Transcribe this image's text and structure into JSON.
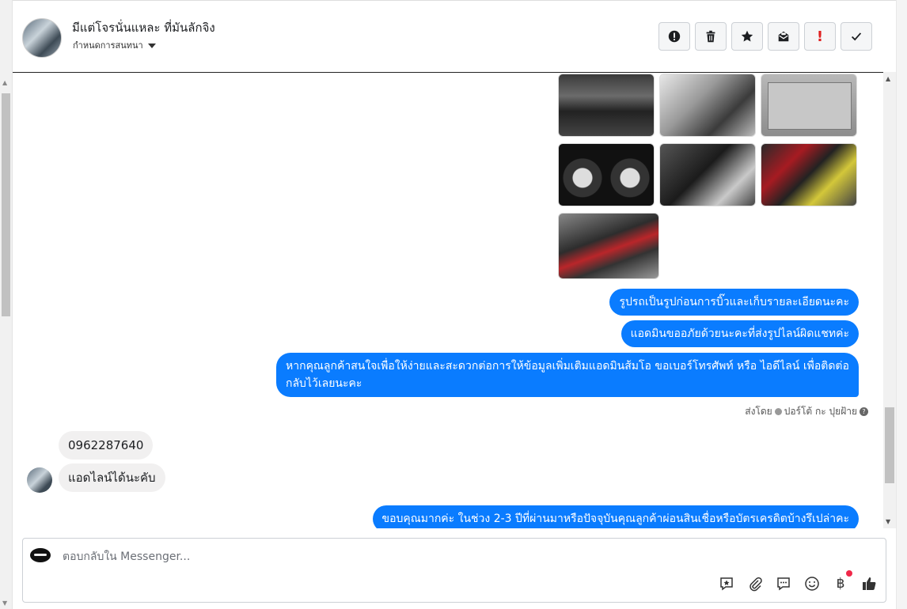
{
  "header": {
    "conversation_name": "มีแต่โจรนั่นแหละ ที่มันลักจิง",
    "assign_label": "กำหนดการสนทนา",
    "actions": [
      {
        "name": "mark-spam-button",
        "icon": "exclamation-circle-icon"
      },
      {
        "name": "delete-button",
        "icon": "trash-icon"
      },
      {
        "name": "star-button",
        "icon": "star-icon"
      },
      {
        "name": "mark-unread-button",
        "icon": "envelope-icon"
      },
      {
        "name": "follow-up-button",
        "icon": "exclamation-icon",
        "text": "!"
      },
      {
        "name": "mark-done-button",
        "icon": "check-icon"
      }
    ]
  },
  "messages": {
    "outgoing": [
      "รูปรถเป็นรูปก่อนการบิ๊วและเก็บรายละเอียดนะคะ",
      "แอดมินขออภัยด้วยนะคะที่ส่งรูปไลน์ผิดแชทค่ะ",
      "หากคุณลูกค้าสนใจเพื่อให้ง่ายและสะดวกต่อการให้ข้อมูลเพิ่มเติมแอดมินส้มโอ ขอเบอร์โทรศัพท์ หรือ ไอดีไลน์ เพื่อติดต่อกลับไว้เลยนะคะ",
      "ขอบคุณมากค่ะ  ในช่วง 2-3 ปีที่ผ่านมาหรือปัจจุบันคุณลูกค้าผ่อนสินเชื่อหรือบัตรเครดิตบ้างรึเปล่าคะ"
    ],
    "sent_by_prefix": "ส่งโดย",
    "sent_by_name": "ปอร์โต้ กะ ปุยฝ้าย",
    "incoming": [
      "0962287640",
      "แอดไลน์ได้นะคับ"
    ],
    "photos": [
      "car-interior-dashboard",
      "car-seat-interior",
      "vehicle-id-plate",
      "instrument-cluster",
      "engine-bay-detail",
      "engine-battery",
      "engine-overview"
    ]
  },
  "composer": {
    "placeholder": "ตอบกลับใน Messenger...",
    "baht_symbol": "฿"
  },
  "colors": {
    "outgoing_bubble": "#0a7cff",
    "incoming_bubble": "#f1f0f0",
    "like_icon": "#333333",
    "notify_dot": "#f02849"
  }
}
